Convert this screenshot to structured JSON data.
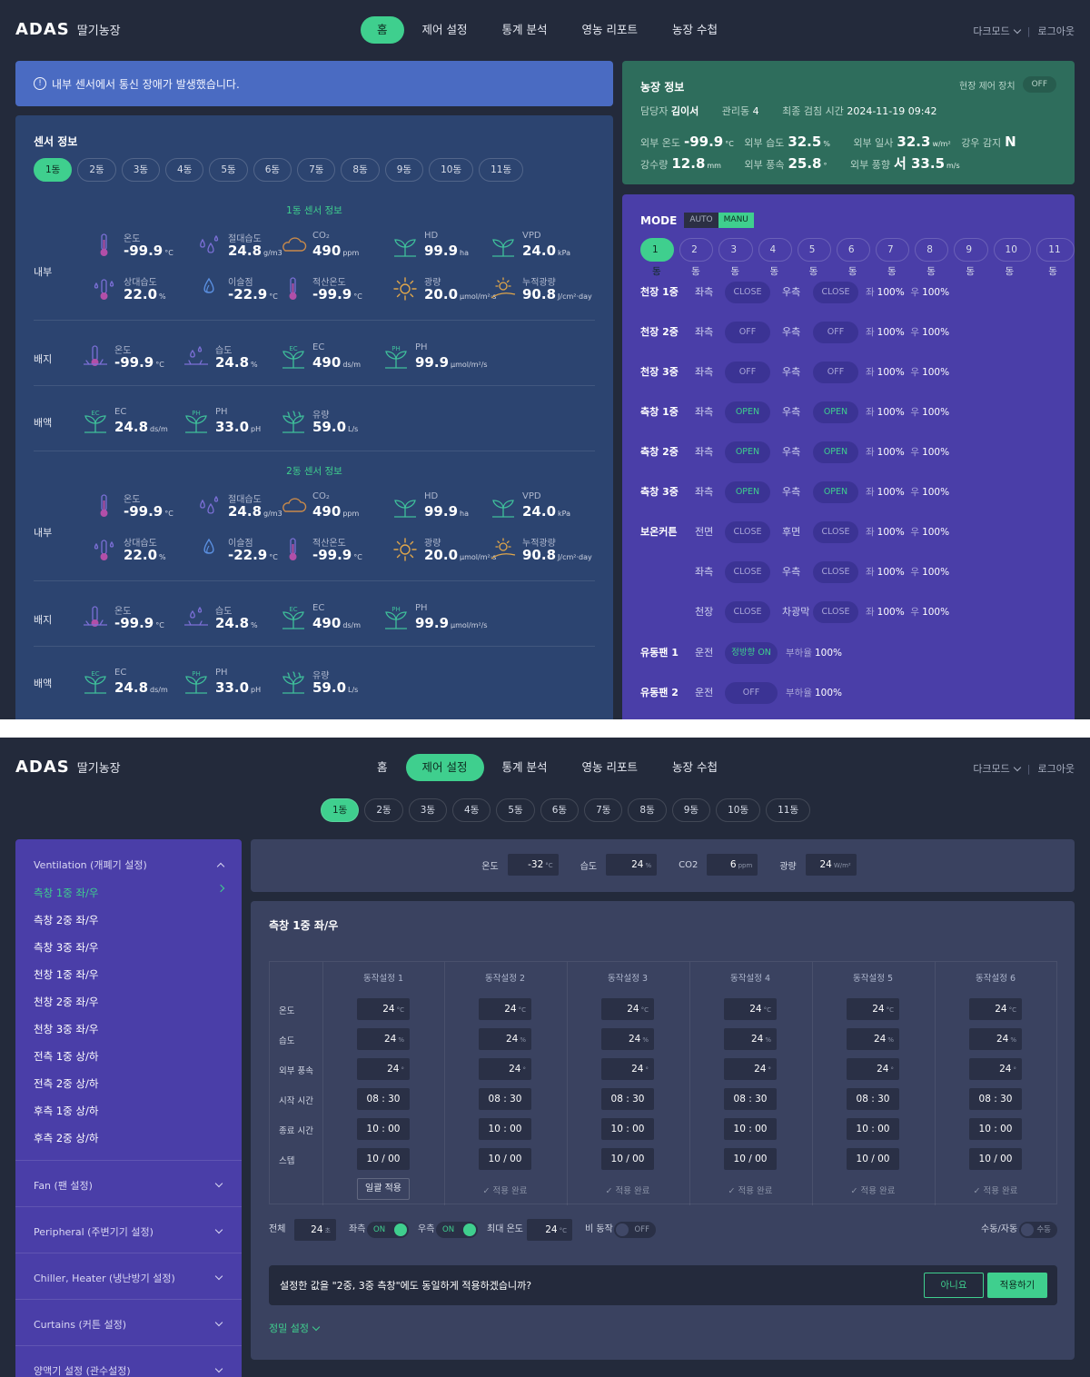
{
  "brand": {
    "logo": "ADAS",
    "farm_name": "딸기농장"
  },
  "nav": [
    "홈",
    "제어 설정",
    "통계 분석",
    "영농 리포트",
    "농장 수첩"
  ],
  "header_right": {
    "darkmode": "다크모드",
    "logout": "로그아웃"
  },
  "screen1": {
    "alert": "내부 센서에서 통신 장애가 발생했습니다.",
    "sensor": {
      "title": "센서 정보",
      "tabs": [
        "1동",
        "2동",
        "3동",
        "4동",
        "5동",
        "6동",
        "7동",
        "8동",
        "9동",
        "10동",
        "11동"
      ],
      "groups": [
        {
          "title": "1동 센서 정보",
          "inner_label": "내부",
          "inner": [
            {
              "label": "온도",
              "value": "-99.9",
              "unit": "°C",
              "icon": "thermometer-icon"
            },
            {
              "label": "절대습도",
              "value": "24.8",
              "unit": "g/m3",
              "icon": "droplets-icon"
            },
            {
              "label": "CO₂",
              "value": "490",
              "unit": "ppm",
              "icon": "cloud-icon"
            },
            {
              "label": "HD",
              "value": "99.9",
              "unit": "ha",
              "icon": "leaf-icon"
            },
            {
              "label": "VPD",
              "value": "24.0",
              "unit": "kPa",
              "icon": "leaf-icon"
            },
            {
              "label": "상대습도",
              "value": "22.0",
              "unit": "%",
              "icon": "thermo-drop-icon"
            },
            {
              "label": "이슬점",
              "value": "-22.9",
              "unit": "°C",
              "icon": "drop-icon"
            },
            {
              "label": "적산온도",
              "value": "-99.9",
              "unit": "°C",
              "icon": "thermometer-icon"
            },
            {
              "label": "광량",
              "value": "20.0",
              "unit": "μmol/m²·s",
              "icon": "sun-icon"
            },
            {
              "label": "누적광량",
              "value": "90.8",
              "unit": "J/cm²·day",
              "icon": "sunrise-icon"
            }
          ],
          "media_label": "배지",
          "media": [
            {
              "label": "온도",
              "value": "-99.9",
              "unit": "°C",
              "icon": "soil-thermometer-icon"
            },
            {
              "label": "습도",
              "value": "24.8",
              "unit": "%",
              "icon": "soil-drop-icon"
            },
            {
              "label": "EC",
              "value": "490",
              "unit": "ds/m",
              "icon": "ec-sprout-icon"
            },
            {
              "label": "PH",
              "value": "99.9",
              "unit": "μmol/m²/s",
              "icon": "ph-sprout-icon"
            }
          ],
          "nutrient_label": "배액",
          "nutrient": [
            {
              "label": "EC",
              "value": "24.8",
              "unit": "ds/m",
              "icon": "ec-leaf-icon"
            },
            {
              "label": "PH",
              "value": "33.0",
              "unit": "pH",
              "icon": "ph-leaf-icon"
            },
            {
              "label": "유량",
              "value": "59.0",
              "unit": "L/s",
              "icon": "flow-leaf-icon"
            }
          ]
        },
        {
          "title": "2동 센서 정보",
          "inner_label": "내부",
          "inner": [
            {
              "label": "온도",
              "value": "-99.9",
              "unit": "°C",
              "icon": "thermometer-icon"
            },
            {
              "label": "절대습도",
              "value": "24.8",
              "unit": "g/m3",
              "icon": "droplets-icon"
            },
            {
              "label": "CO₂",
              "value": "490",
              "unit": "ppm",
              "icon": "cloud-icon"
            },
            {
              "label": "HD",
              "value": "99.9",
              "unit": "ha",
              "icon": "leaf-icon"
            },
            {
              "label": "VPD",
              "value": "24.0",
              "unit": "kPa",
              "icon": "leaf-icon"
            },
            {
              "label": "상대습도",
              "value": "22.0",
              "unit": "%",
              "icon": "thermo-drop-icon"
            },
            {
              "label": "이슬점",
              "value": "-22.9",
              "unit": "°C",
              "icon": "drop-icon"
            },
            {
              "label": "적산온도",
              "value": "-99.9",
              "unit": "°C",
              "icon": "thermometer-icon"
            },
            {
              "label": "광량",
              "value": "20.0",
              "unit": "μmol/m²·s",
              "icon": "sun-icon"
            },
            {
              "label": "누적광량",
              "value": "90.8",
              "unit": "J/cm²·day",
              "icon": "sunrise-icon"
            }
          ],
          "media_label": "배지",
          "media": [
            {
              "label": "온도",
              "value": "-99.9",
              "unit": "°C",
              "icon": "soil-thermometer-icon"
            },
            {
              "label": "습도",
              "value": "24.8",
              "unit": "%",
              "icon": "soil-drop-icon"
            },
            {
              "label": "EC",
              "value": "490",
              "unit": "ds/m",
              "icon": "ec-sprout-icon"
            },
            {
              "label": "PH",
              "value": "99.9",
              "unit": "μmol/m²/s",
              "icon": "ph-sprout-icon"
            }
          ],
          "nutrient_label": "배액",
          "nutrient": [
            {
              "label": "EC",
              "value": "24.8",
              "unit": "ds/m",
              "icon": "ec-leaf-icon"
            },
            {
              "label": "PH",
              "value": "33.0",
              "unit": "pH",
              "icon": "ph-leaf-icon"
            },
            {
              "label": "유량",
              "value": "59.0",
              "unit": "L/s",
              "icon": "flow-leaf-icon"
            }
          ]
        }
      ]
    },
    "farm": {
      "title": "농장 정보",
      "onsite_label": "현장 제어 장치",
      "onsite_state": "OFF",
      "manager_label": "담당자",
      "manager": "김이서",
      "buildings_label": "관리동",
      "buildings": "4",
      "last_check_label": "최종 검침 시간",
      "last_check": "2024-11-19  09:42",
      "out_temp_label": "외부 온도",
      "out_temp": "-99.9",
      "out_temp_unit": "°C",
      "out_hum_label": "외부 습도",
      "out_hum": "32.5",
      "out_hum_unit": "%",
      "out_sun_label": "외부 일사",
      "out_sun": "32.3",
      "out_sun_unit": "w/m²",
      "rain_label": "강우 감지",
      "rain": "N",
      "rainfall_label": "강수량",
      "rainfall": "12.8",
      "rainfall_unit": "mm",
      "wind_speed_label": "외부 풍속",
      "wind_speed": "25.8",
      "wind_speed_unit": "°",
      "wind_dir_label": "외부 풍향",
      "wind_dir": "서 33.5",
      "wind_dir_unit": "m/s"
    },
    "mode": {
      "title": "MODE",
      "auto": "AUTO",
      "manu": "MANU",
      "tabs": [
        "1동",
        "2동",
        "3동",
        "4동",
        "5동",
        "6동",
        "7동",
        "8동",
        "9동",
        "10동",
        "11동"
      ],
      "rows": [
        {
          "name": "천장 1중",
          "l": "좌측",
          "ls": "CLOSE",
          "r": "우측",
          "rs": "CLOSE",
          "lp": "100",
          "rp": "100"
        },
        {
          "name": "천장 2중",
          "l": "좌측",
          "ls": "OFF",
          "r": "우측",
          "rs": "OFF",
          "lp": "100",
          "rp": "100"
        },
        {
          "name": "천장 3중",
          "l": "좌측",
          "ls": "OFF",
          "r": "우측",
          "rs": "OFF",
          "lp": "100",
          "rp": "100"
        },
        {
          "name": "측창 1중",
          "l": "좌측",
          "ls": "OPEN",
          "r": "우측",
          "rs": "OPEN",
          "lp": "100",
          "rp": "100"
        },
        {
          "name": "측창 2중",
          "l": "좌측",
          "ls": "OPEN",
          "r": "우측",
          "rs": "OPEN",
          "lp": "100",
          "rp": "100"
        },
        {
          "name": "측창 3중",
          "l": "좌측",
          "ls": "OPEN",
          "r": "우측",
          "rs": "OPEN",
          "lp": "100",
          "rp": "100"
        },
        {
          "name": "보온커튼",
          "l": "전면",
          "ls": "CLOSE",
          "r": "후면",
          "rs": "CLOSE",
          "lp": "100",
          "rp": "100"
        },
        {
          "name": "",
          "l": "좌측",
          "ls": "CLOSE",
          "r": "우측",
          "rs": "CLOSE",
          "lp": "100",
          "rp": "100"
        },
        {
          "name": "",
          "l": "천장",
          "ls": "CLOSE",
          "r": "차광막",
          "rs": "CLOSE",
          "lp": "100",
          "rp": "100"
        }
      ],
      "pct_left": "좌",
      "pct_right": "우",
      "pct_unit": "%",
      "fans": [
        {
          "name": "유동팬 1",
          "run": "운전",
          "state": "정방향 ON",
          "load_label": "부하율",
          "load": "100"
        },
        {
          "name": "유동팬 2",
          "run": "운전",
          "state": "OFF",
          "load_label": "부하율",
          "load": "100"
        }
      ]
    }
  },
  "screen2": {
    "tabs": [
      "1동",
      "2동",
      "3동",
      "4동",
      "5동",
      "6동",
      "7동",
      "8동",
      "9동",
      "10동",
      "11동"
    ],
    "sidebar": {
      "ventilation": "Ventilation (개폐기 설정)",
      "items": [
        "측창 1중 좌/우",
        "측창 2중 좌/우",
        "측창 3중 좌/우",
        "천창 1중 좌/우",
        "천창 2중 좌/우",
        "천창 3중 좌/우",
        "전측 1중 상/하",
        "전측 2중 상/하",
        "후측 1중 상/하",
        "후측 2중 상/하"
      ],
      "groups": [
        "Fan (팬 설정)",
        "Peripheral (주변기기 설정)",
        "Chiller, Heater (냉난방기 설정)",
        "Curtains (커튼 설정)",
        "양액기 설정 (관수설정)"
      ]
    },
    "topbar": [
      {
        "label": "온도",
        "value": "-32",
        "unit": "°C"
      },
      {
        "label": "습도",
        "value": "24",
        "unit": "%"
      },
      {
        "label": "CO2",
        "value": "6",
        "unit": "ppm"
      },
      {
        "label": "광량",
        "value": "24",
        "unit": "W/m²"
      }
    ],
    "panel_title": "측창 1중 좌/우",
    "columns": [
      "동작설정 1",
      "동작설정 2",
      "동작설정 3",
      "동작설정 4",
      "동작설정 5",
      "동작설정 6"
    ],
    "row_labels": [
      "온도",
      "습도",
      "외부 풍속",
      "시작 시간",
      "종료 시간",
      "스텝"
    ],
    "cells": {
      "temp": "24",
      "temp_unit": "°C",
      "hum": "24",
      "hum_unit": "%",
      "wind": "24",
      "wind_unit": "°",
      "start": "08  :  30",
      "end": "10  :  00",
      "step": "10  /  00"
    },
    "apply_all": "일괄 적용",
    "done": "✓ 적용 완료",
    "bottom": {
      "total_label": "전체",
      "total": "24",
      "total_unit": "초",
      "left_label": "좌측",
      "left_state": "ON",
      "right_label": "우측",
      "right_state": "ON",
      "max_temp_label": "최대 온도",
      "max_temp": "24",
      "max_temp_unit": "°C",
      "rain_label": "비 동작",
      "rain_state": "OFF",
      "manual_label": "수동/자동",
      "manual_state": "수동"
    },
    "confirm": {
      "question": "설정한 값을 \"2중, 3중 측창\"에도 동일하게 적용하겠습니까?",
      "no": "아니요",
      "yes": "적용하기"
    },
    "precise": "정밀 설정"
  }
}
